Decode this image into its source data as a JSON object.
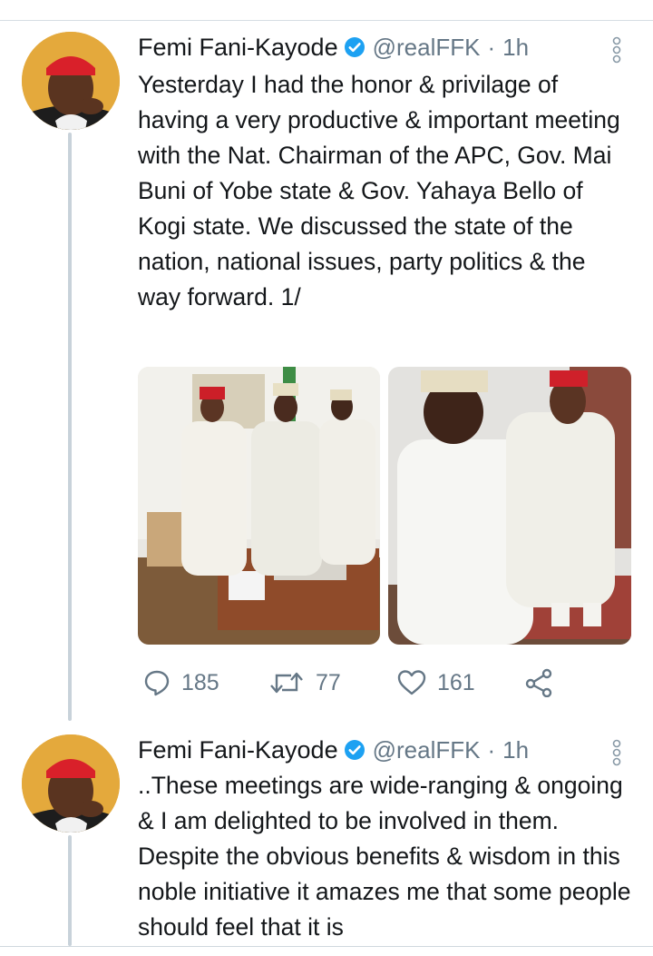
{
  "tweets": [
    {
      "author_name": "Femi Fani-Kayode",
      "handle": "@realFFK",
      "separator": "·",
      "time": "1h",
      "text": "Yesterday I had the honor & privilage of having a very productive & important meeting with the Nat. Chairman of the APC, Gov. Mai Buni of Yobe state & Gov. Yahaya Bello of Kogi state. We discussed the state of the nation, national issues, party politics & the way forward. 1/",
      "media": [
        "photo-group-meeting",
        "photo-two-men-talking"
      ],
      "replies": "185",
      "retweets": "77",
      "likes": "161"
    },
    {
      "author_name": "Femi Fani-Kayode",
      "handle": "@realFFK",
      "separator": "·",
      "time": "1h",
      "text": "..These meetings are wide-ranging & ongoing & I am delighted to be involved in them. Despite the obvious benefits & wisdom in this noble initiative it amazes me that some people should feel that it is"
    }
  ],
  "icons": [
    "verified-icon",
    "more-icon",
    "reply-icon",
    "retweet-icon",
    "like-icon",
    "share-icon"
  ],
  "colors": {
    "verified": "#1da1f2",
    "muted": "#657786",
    "text": "#14171a",
    "thread_line": "#c8d2da"
  }
}
